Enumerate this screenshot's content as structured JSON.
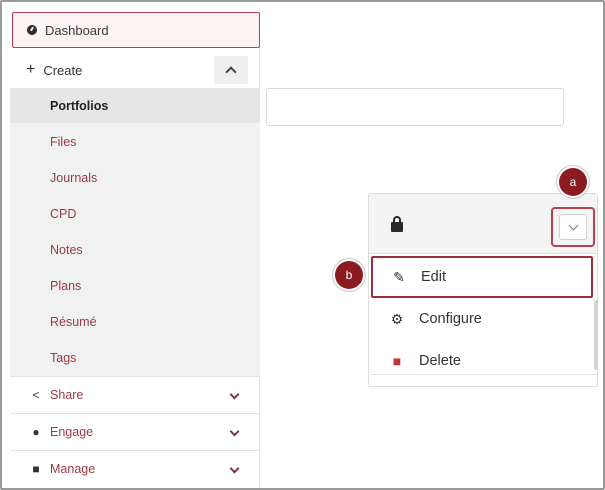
{
  "sidebar": {
    "dashboard_label": "Dashboard",
    "create": {
      "label": "Create",
      "expanded": true
    },
    "create_items": [
      {
        "label": "Portfolios",
        "active": true
      },
      {
        "label": "Files"
      },
      {
        "label": "Journals"
      },
      {
        "label": "CPD"
      },
      {
        "label": "Notes"
      },
      {
        "label": "Plans"
      },
      {
        "label": "Résumé"
      },
      {
        "label": "Tags"
      }
    ],
    "sections": [
      {
        "label": "Share",
        "icon": "share-icon"
      },
      {
        "label": "Engage",
        "icon": "people-icon"
      },
      {
        "label": "Manage",
        "icon": "briefcase-icon"
      }
    ]
  },
  "dropdown": {
    "items": [
      {
        "label": "Edit",
        "icon": "pencil-icon"
      },
      {
        "label": "Configure",
        "icon": "cogs-icon"
      },
      {
        "label": "Delete",
        "icon": "trash-icon"
      }
    ]
  },
  "callouts": {
    "a": "a",
    "b": "b"
  },
  "colors": {
    "accent": "#9b3a44",
    "callout": "#8c1c22",
    "submenu_bg": "#f1f1f1"
  }
}
